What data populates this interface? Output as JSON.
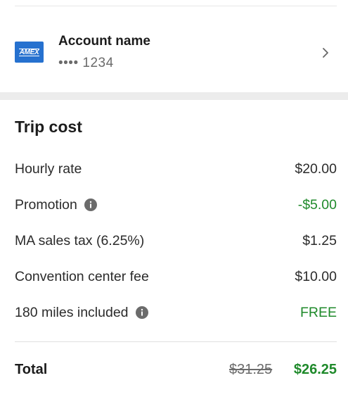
{
  "payment": {
    "card_brand_logo": "AMEX",
    "account_name": "Account name",
    "card_number": "•••• 1234",
    "chevron_icon": "chevron-right"
  },
  "trip_cost": {
    "title": "Trip cost",
    "items": [
      {
        "label": "Hourly rate",
        "value": "$20.00",
        "value_color": "#2b2b2b",
        "info_icon": false
      },
      {
        "label": "Promotion",
        "value": "-$5.00",
        "value_color": "#1f8a2b",
        "info_icon": true
      },
      {
        "label": "MA sales tax (6.25%)",
        "value": "$1.25",
        "value_color": "#2b2b2b",
        "info_icon": false
      },
      {
        "label": "Convention center fee",
        "value": "$10.00",
        "value_color": "#2b2b2b",
        "info_icon": false
      },
      {
        "label": "180 miles included",
        "value": "FREE",
        "value_color": "#1f8a2b",
        "info_icon": true
      }
    ],
    "total": {
      "label": "Total",
      "original": "$31.25",
      "final": "$26.25"
    }
  },
  "colors": {
    "brand_card": "#2671cf",
    "discount_green": "#1f8a2b",
    "section_band": "#ececec"
  }
}
